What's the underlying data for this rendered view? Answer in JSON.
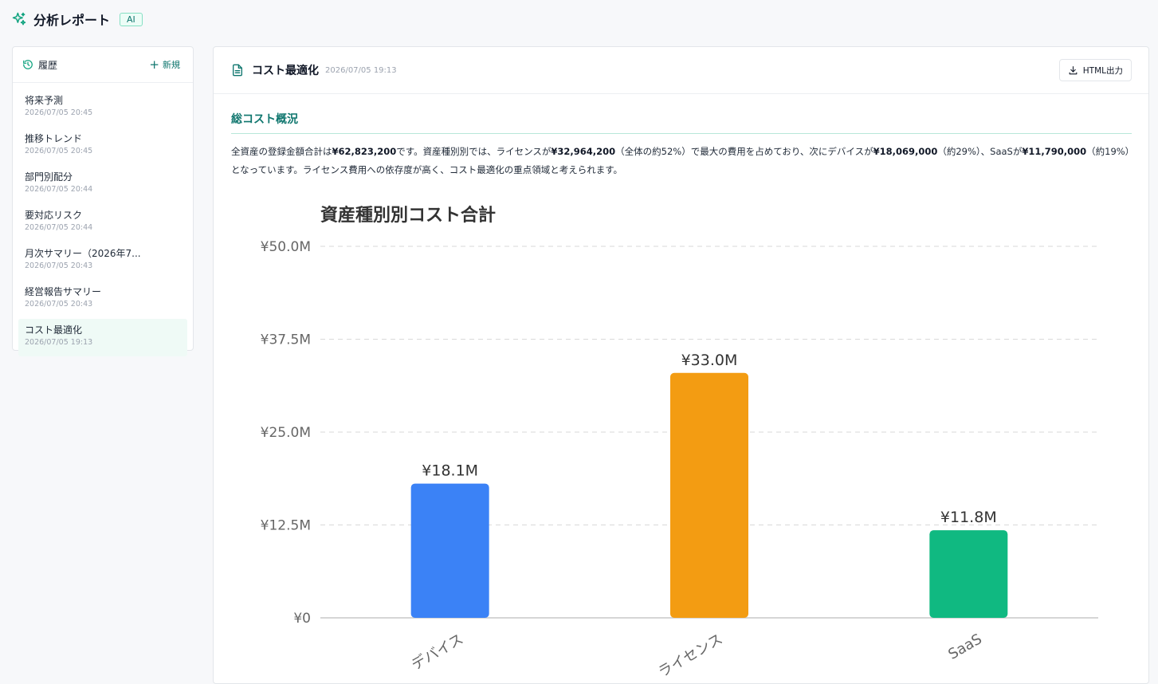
{
  "app": {
    "title": "分析レポート",
    "badge": "AI",
    "spark_icon": "sparkle-icon"
  },
  "sidebar": {
    "title": "履歴",
    "new_label": "新規",
    "items": [
      {
        "title": "将来予測",
        "time": "2026/07/05 20:45"
      },
      {
        "title": "推移トレンド",
        "time": "2026/07/05 20:45"
      },
      {
        "title": "部門別配分",
        "time": "2026/07/05 20:44"
      },
      {
        "title": "要対応リスク",
        "time": "2026/07/05 20:44"
      },
      {
        "title": "月次サマリー（2026年7...",
        "time": "2026/07/05 20:43"
      },
      {
        "title": "経営報告サマリー",
        "time": "2026/07/05 20:43"
      },
      {
        "title": "コスト最適化",
        "time": "2026/07/05 19:13",
        "active": true
      }
    ]
  },
  "report": {
    "title": "コスト最適化",
    "time": "2026/07/05 19:13",
    "export_label": "HTML出力",
    "section_title": "総コスト概況",
    "paragraph": {
      "p1": "全資産の登録金額合計は",
      "v1": "¥62,823,200",
      "p2": "です。資産種別別では、ライセンスが",
      "v2": "¥32,964,200",
      "p3": "（全体の約52%）で最大の費用を占めており、次にデバイスが",
      "v3": "¥18,069,000",
      "p4": "（約29%）、SaaSが",
      "v4": "¥11,790,000",
      "p5": "（約19%）となっています。ライセンス費用への依存度が高く、コスト最適化の重点領域と考えられます。"
    }
  },
  "colors": {
    "accent": "#0f766e",
    "bar_device": "#3b82f6",
    "bar_license": "#f39c12",
    "bar_saas": "#10b981"
  },
  "chart_data": {
    "type": "bar",
    "title": "資産種別別コスト合計",
    "categories": [
      "デバイス",
      "ライセンス",
      "SaaS"
    ],
    "values": [
      18069000,
      32964200,
      11790000
    ],
    "data_labels": [
      "¥18.1M",
      "¥33.0M",
      "¥11.8M"
    ],
    "colors": [
      "#3b82f6",
      "#f39c12",
      "#10b981"
    ],
    "ylim": [
      0,
      50000000
    ],
    "yticks": [
      0,
      12500000,
      25000000,
      37500000,
      50000000
    ],
    "ytick_labels": [
      "¥0",
      "¥12.5M",
      "¥25.0M",
      "¥37.5M",
      "¥50.0M"
    ],
    "grid": true,
    "xlabel": "",
    "ylabel": ""
  }
}
